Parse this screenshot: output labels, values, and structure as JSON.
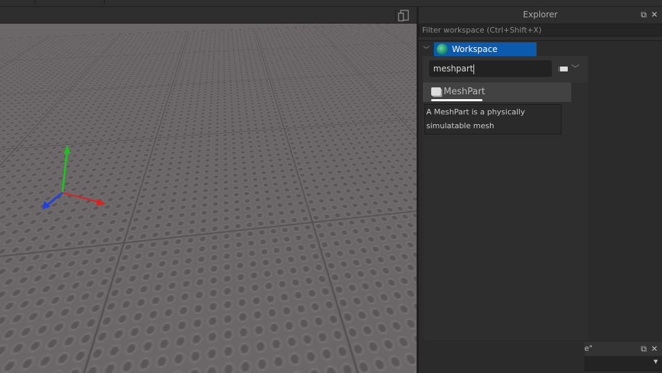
{
  "explorer": {
    "title": "Explorer",
    "filter_placeholder": "Filter workspace (Ctrl+Shift+X)",
    "tree": {
      "root": "Workspace",
      "selected": true
    },
    "insert_popup": {
      "search_value": "meshpart",
      "results": [
        {
          "label": "MeshPart",
          "icon": "meshpart-icon"
        }
      ],
      "tooltip": "A MeshPart is a physically simulatable mesh"
    }
  },
  "bottom_panel": {
    "title_fragment": "e\""
  },
  "toolbar": {
    "device_icon": "device-emulator-icon"
  },
  "colors": {
    "selection": "#0b5aad",
    "x_axis": "#e02020",
    "y_axis": "#20c020",
    "z_axis": "#2040e0"
  }
}
